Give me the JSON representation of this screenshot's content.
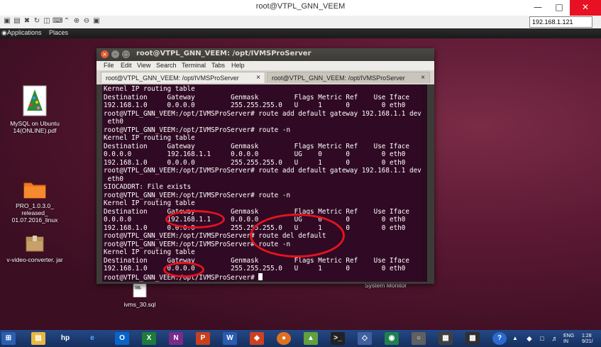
{
  "vnc": {
    "title": "root@VTPL_GNN_VEEM",
    "address": "192.168.1.121"
  },
  "panel": {
    "applications": "Applications",
    "places": "Places"
  },
  "desktop_icons": [
    {
      "label": "MySQL on Ubuntu 14(ONLINE).pdf",
      "icon": "pdf-file-icon"
    },
    {
      "label": "PRO_1.0.3.0_ released_ 01.07.2016_linux",
      "icon": "folder-icon"
    },
    {
      "label": "v-video-converter. jar",
      "icon": "jar-file-icon"
    },
    {
      "label": "ivms_30.sql",
      "icon": "sql-file-icon"
    },
    {
      "label": "System Monitor",
      "icon": "system-monitor-icon"
    }
  ],
  "terminal": {
    "title": "root@VTPL_GNN_VEEM: /opt/IVMSProServer",
    "menu": [
      "File",
      "Edit",
      "View",
      "Search",
      "Terminal",
      "Tabs",
      "Help"
    ],
    "tabs": [
      {
        "label": "root@VTPL_GNN_VEEM: /opt/IVMSProServer",
        "close": "×"
      },
      {
        "label": "root@VTPL_GNN_VEEM: /opt/IVMSProServer",
        "close": "×"
      }
    ],
    "lines": [
      "Kernel IP routing table",
      "Destination     Gateway         Genmask         Flags Metric Ref    Use Iface",
      "192.168.1.0     0.0.0.0         255.255.255.0   U     1      0        0 eth0",
      "root@VTPL_GNN_VEEM:/opt/IVMSProServer# route add default gateway 192.168.1.1 dev",
      " eth0",
      "root@VTPL_GNN_VEEM:/opt/IVMSProServer# route -n",
      "Kernel IP routing table",
      "Destination     Gateway         Genmask         Flags Metric Ref    Use Iface",
      "0.0.0.0         192.168.1.1     0.0.0.0         UG    0      0        0 eth0",
      "192.168.1.0     0.0.0.0         255.255.255.0   U     1      0        0 eth0",
      "root@VTPL_GNN_VEEM:/opt/IVMSProServer# route add default gateway 192.168.1.1 dev",
      " eth0",
      "SIOCADDRT: File exists",
      "root@VTPL_GNN_VEEM:/opt/IVMSProServer# route -n",
      "Kernel IP routing table",
      "Destination     Gateway         Genmask         Flags Metric Ref    Use Iface",
      "0.0.0.0         192.168.1.1     0.0.0.0         UG    0      0        0 eth0",
      "192.168.1.0     0.0.0.0         255.255.255.0   U     1      0        0 eth0",
      "root@VTPL_GNN_VEEM:/opt/IVMSProServer# route del default",
      "root@VTPL_GNN_VEEM:/opt/IVMSProServer# route -n",
      "Kernel IP routing table",
      "Destination     Gateway         Genmask         Flags Metric Ref    Use Iface",
      "192.168.1.0     0.0.0.0         255.255.255.0   U     1      0        0 eth0",
      "root@VTPL_GNN_VEEM:/opt/IVMSProServer# "
    ]
  },
  "taskbar": {
    "lang": "ENG",
    "region": "IN",
    "time": "1:28",
    "date": "9/21/"
  },
  "colors": {
    "terminal_bg": "#300a24",
    "annotation": "#e5131f",
    "taskbar": "#1f3b73"
  }
}
